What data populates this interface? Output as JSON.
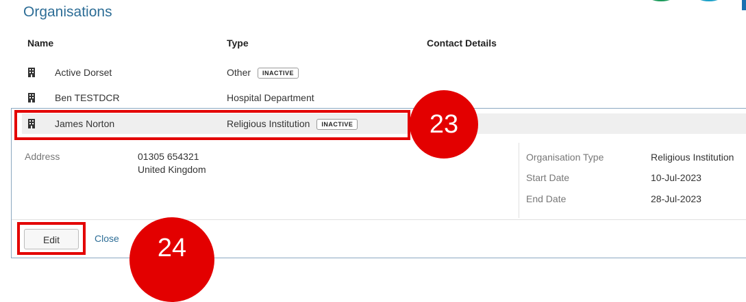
{
  "page": {
    "title": "Organisations"
  },
  "table": {
    "headers": {
      "name": "Name",
      "type": "Type",
      "contact": "Contact Details"
    },
    "rows": [
      {
        "name": "Active Dorset",
        "type": "Other",
        "badge": "INACTIVE"
      },
      {
        "name": "Ben TESTDCR",
        "type": "Hospital Department",
        "badge": ""
      },
      {
        "name": "James Norton",
        "type": "Religious Institution",
        "badge": "INACTIVE"
      }
    ]
  },
  "details": {
    "address_label": "Address",
    "address_line1": "01305 654321",
    "address_line2": "United Kingdom",
    "org_type_label": "Organisation Type",
    "org_type_value": "Religious Institution",
    "start_label": "Start Date",
    "start_value": "10-Jul-2023",
    "end_label": "End Date",
    "end_value": "28-Jul-2023"
  },
  "actions": {
    "edit_label": "Edit",
    "close_label": "Close"
  },
  "annotations": {
    "step_a": "23",
    "step_b": "24"
  },
  "colors": {
    "accent": "#2d6d96",
    "highlight_red": "#e30000"
  },
  "icons": {
    "row_icon": "building-icon"
  }
}
